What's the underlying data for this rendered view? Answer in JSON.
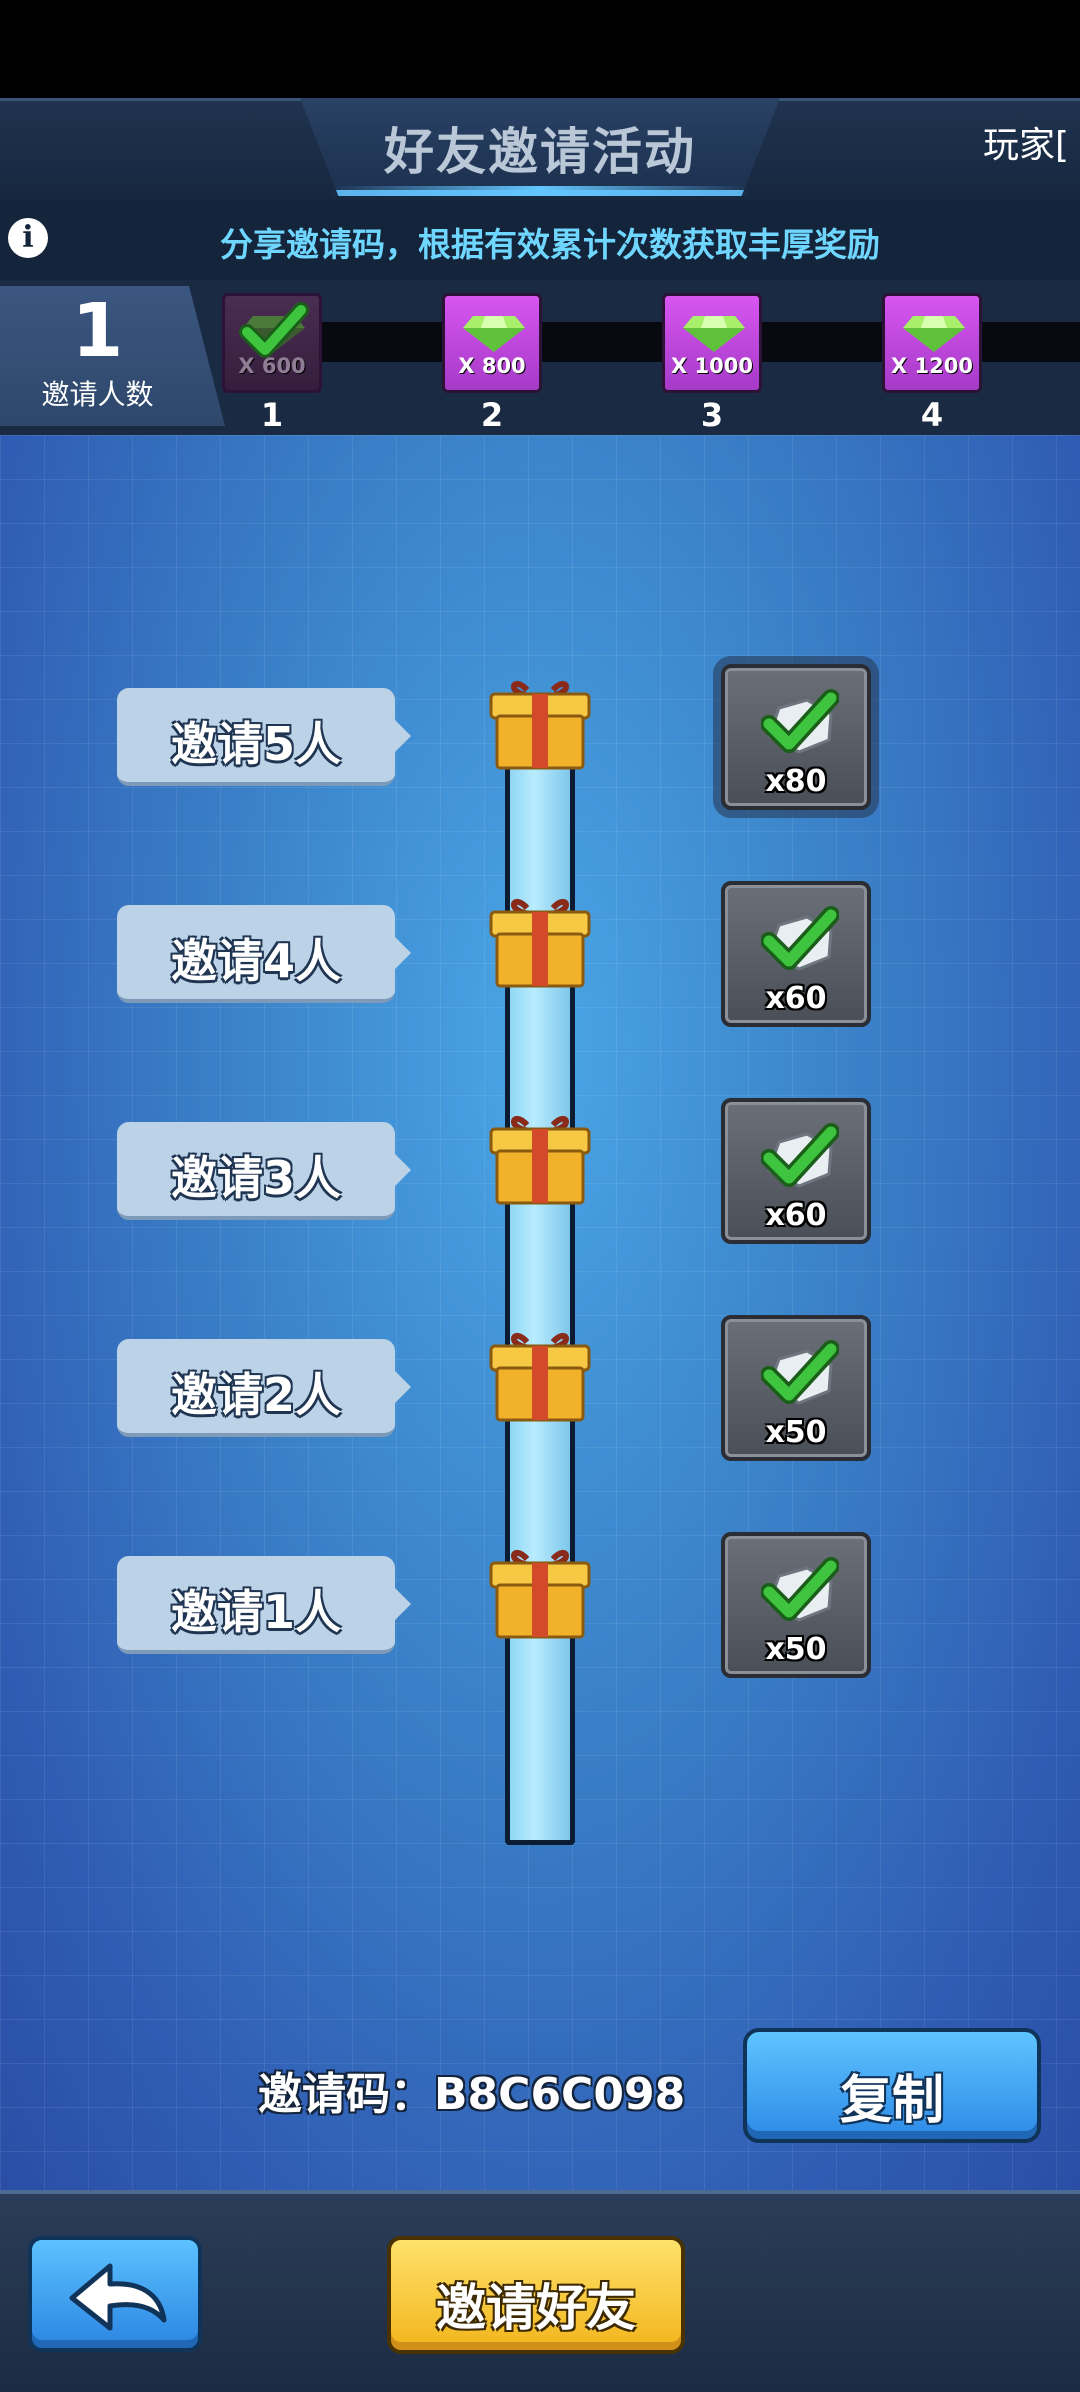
{
  "header": {
    "title": "好友邀请活动",
    "player_label": "玩家["
  },
  "subheader": {
    "info_icon": "info-icon",
    "subtitle": "分享邀请码，根据有效累计次数获取丰厚奖励"
  },
  "invite_progress": {
    "count": "1",
    "count_label": "邀请人数",
    "tiers": [
      {
        "number": "1",
        "amount": "X 600",
        "icon": "gem",
        "claimed": true
      },
      {
        "number": "2",
        "amount": "X 800",
        "icon": "gem",
        "claimed": false
      },
      {
        "number": "3",
        "amount": "X 1000",
        "icon": "gem",
        "claimed": false
      },
      {
        "number": "4",
        "amount": "X 1200",
        "icon": "gem",
        "claimed": false
      }
    ],
    "progress_fraction": 0.06
  },
  "milestones": [
    {
      "label": "邀请5人",
      "reward_qty": "x80",
      "claimed": true,
      "selected": true
    },
    {
      "label": "邀请4人",
      "reward_qty": "x60",
      "claimed": true,
      "selected": false
    },
    {
      "label": "邀请3人",
      "reward_qty": "x60",
      "claimed": true,
      "selected": false
    },
    {
      "label": "邀请2人",
      "reward_qty": "x50",
      "claimed": true,
      "selected": false
    },
    {
      "label": "邀请1人",
      "reward_qty": "x50",
      "claimed": true,
      "selected": false
    }
  ],
  "invite_code": {
    "label": "邀请码：B8C6C098",
    "copy_label": "复制"
  },
  "bottom_bar": {
    "back_icon": "back-arrow-icon",
    "invite_friends_label": "邀请好友"
  },
  "colors": {
    "tier_gem": "#d756f0",
    "gem_green": "#7be04a",
    "check_green": "#3ec43e",
    "copy_blue": "#2e8ae6",
    "invite_gold": "#f2b51c"
  }
}
